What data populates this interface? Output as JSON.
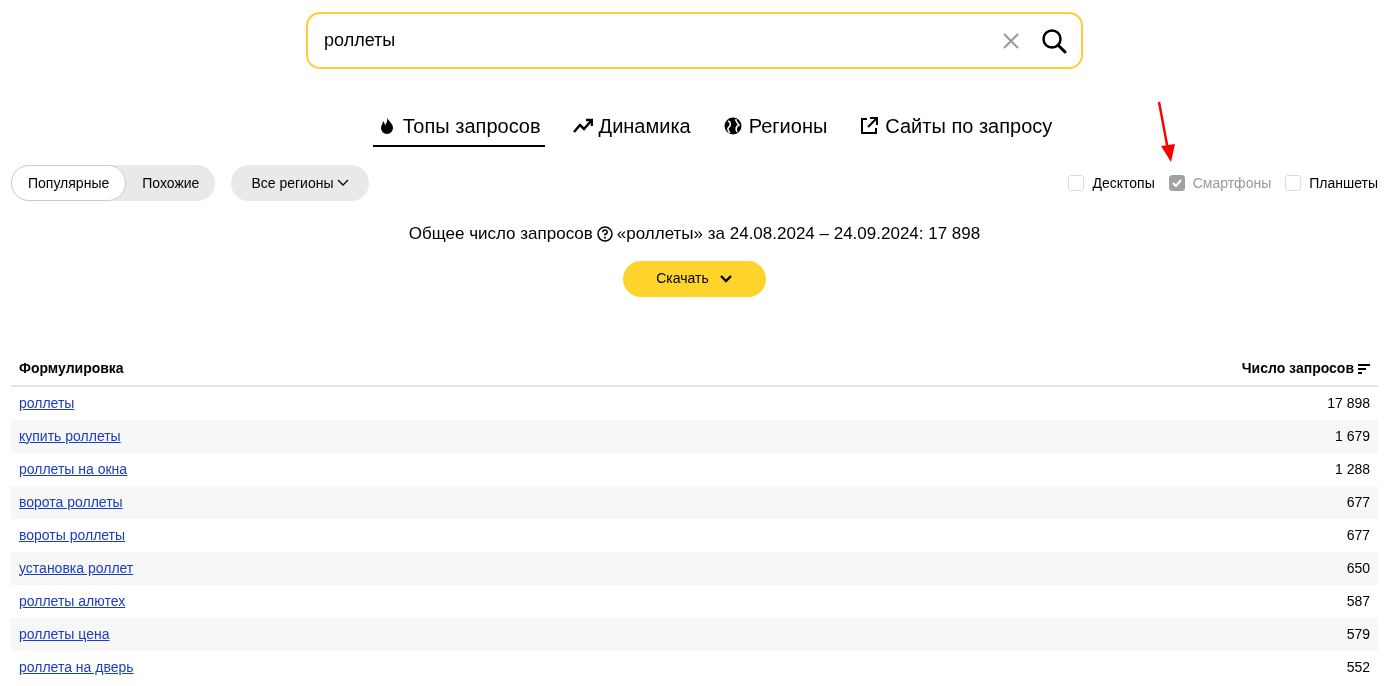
{
  "search": {
    "value": "роллеты"
  },
  "tabs": [
    {
      "label": "Топы запросов",
      "selected": true
    },
    {
      "label": "Динамика",
      "selected": false
    },
    {
      "label": "Регионы",
      "selected": false
    },
    {
      "label": "Сайты по запросу",
      "selected": false
    }
  ],
  "mode_toggle": [
    {
      "label": "Популярные",
      "selected": true
    },
    {
      "label": "Похожие",
      "selected": false
    }
  ],
  "region_button": {
    "label": "Все регионы"
  },
  "devices": [
    {
      "label": "Десктопы",
      "checked": false,
      "disabled": false
    },
    {
      "label": "Смартфоны",
      "checked": true,
      "disabled": true
    },
    {
      "label": "Планшеты",
      "checked": false,
      "disabled": false
    }
  ],
  "summary": {
    "label": "Общее число запросов",
    "details": "«роллеты» за 24.08.2024 – 24.09.2024: 17 898"
  },
  "download_button": {
    "label": "Скачать"
  },
  "table": {
    "columns": [
      "Формулировка",
      "Число запросов"
    ],
    "rows": [
      [
        "роллеты",
        "17 898"
      ],
      [
        "купить роллеты",
        "1 679"
      ],
      [
        "роллеты на окна",
        "1 288"
      ],
      [
        "ворота роллеты",
        "677"
      ],
      [
        "вороты роллеты",
        "677"
      ],
      [
        "установка роллет",
        "650"
      ],
      [
        "роллеты алютех",
        "587"
      ],
      [
        "роллеты цена",
        "579"
      ],
      [
        "роллета на дверь",
        "552"
      ]
    ]
  }
}
